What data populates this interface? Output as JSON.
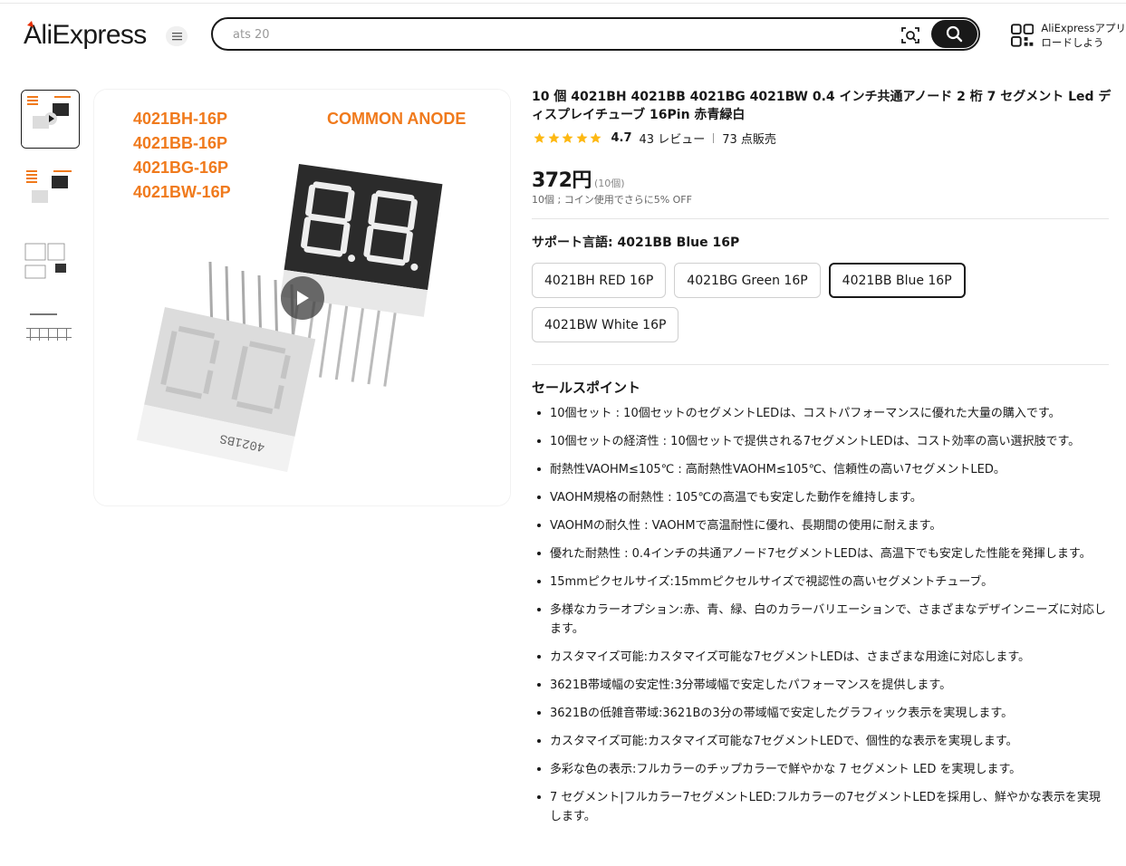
{
  "header": {
    "logo_text": "AliExpress",
    "search_placeholder": "ats 20",
    "menu_icon": "hamburger-icon",
    "app_promo_line1": "AliExpressアプリ",
    "app_promo_line2": "ロードしよう"
  },
  "gallery": {
    "image_labels": [
      "4021BH-16P",
      "4021BB-16P",
      "4021BG-16P",
      "4021BW-16P"
    ],
    "image_heading": "COMMON ANODE",
    "thumbnail_count": 4
  },
  "product": {
    "title": "10 個 4021BH 4021BB 4021BG 4021BW 0.4 インチ共通アノード 2 桁 7 セグメント Led ディスプレイチューブ 16Pin 赤青緑白",
    "rating": "4.7",
    "reviews": "43 レビュー",
    "sold": "73 点販売",
    "price": "372円",
    "price_unit": "(10個)",
    "price_note": "10個 ; コイン使用でさらに5% OFF",
    "sku_label": "サポート言語: 4021BB Blue 16P",
    "sku_options": [
      "4021BH RED 16P",
      "4021BG Green 16P",
      "4021BB Blue 16P",
      "4021BW White 16P"
    ],
    "highlights_title": "セールスポイント",
    "highlights": [
      "10個セット : 10個セットのセグメントLEDは、コストパフォーマンスに優れた大量の購入です。",
      "10個セットの経済性 : 10個セットで提供される7セグメントLEDは、コスト効率の高い選択肢です。",
      "耐熱性VAOHM≤105℃ : 高耐熱性VAOHM≤105℃、信頼性の高い7セグメントLED。",
      "VAOHM規格の耐熱性 : 105℃の高温でも安定した動作を維持します。",
      "VAOHMの耐久性 : VAOHMで高温耐性に優れ、長期間の使用に耐えます。",
      "優れた耐熱性 : 0.4インチの共通アノード7セグメントLEDは、高温下でも安定した性能を発揮します。",
      "15mmピクセルサイズ:15mmピクセルサイズで視認性の高いセグメントチューブ。",
      "多様なカラーオプション:赤、青、緑、白のカラーバリエーションで、さまざまなデザインニーズに対応します。",
      "カスタマイズ可能:カスタマイズ可能な7セグメントLEDは、さまざまな用途に対応します。",
      "3621B帯域幅の安定性:3分帯域幅で安定したパフォーマンスを提供します。",
      "3621Bの低雑音帯域:3621Bの3分の帯域幅で安定したグラフィック表示を実現します。",
      "カスタマイズ可能:カスタマイズ可能な7セグメントLEDで、個性的な表示を実現します。",
      "多彩な色の表示:フルカラーのチップカラーで鮮やかな 7 セグメント LED を実現します。",
      "7 セグメント|フルカラー7セグメントLED:フルカラーの7セグメントLEDを採用し、鮮やかな表示を実現します。"
    ]
  },
  "colors": {
    "brand_red": "#e62e04",
    "star": "#fdb812",
    "label_orange": "#f07a1c"
  }
}
